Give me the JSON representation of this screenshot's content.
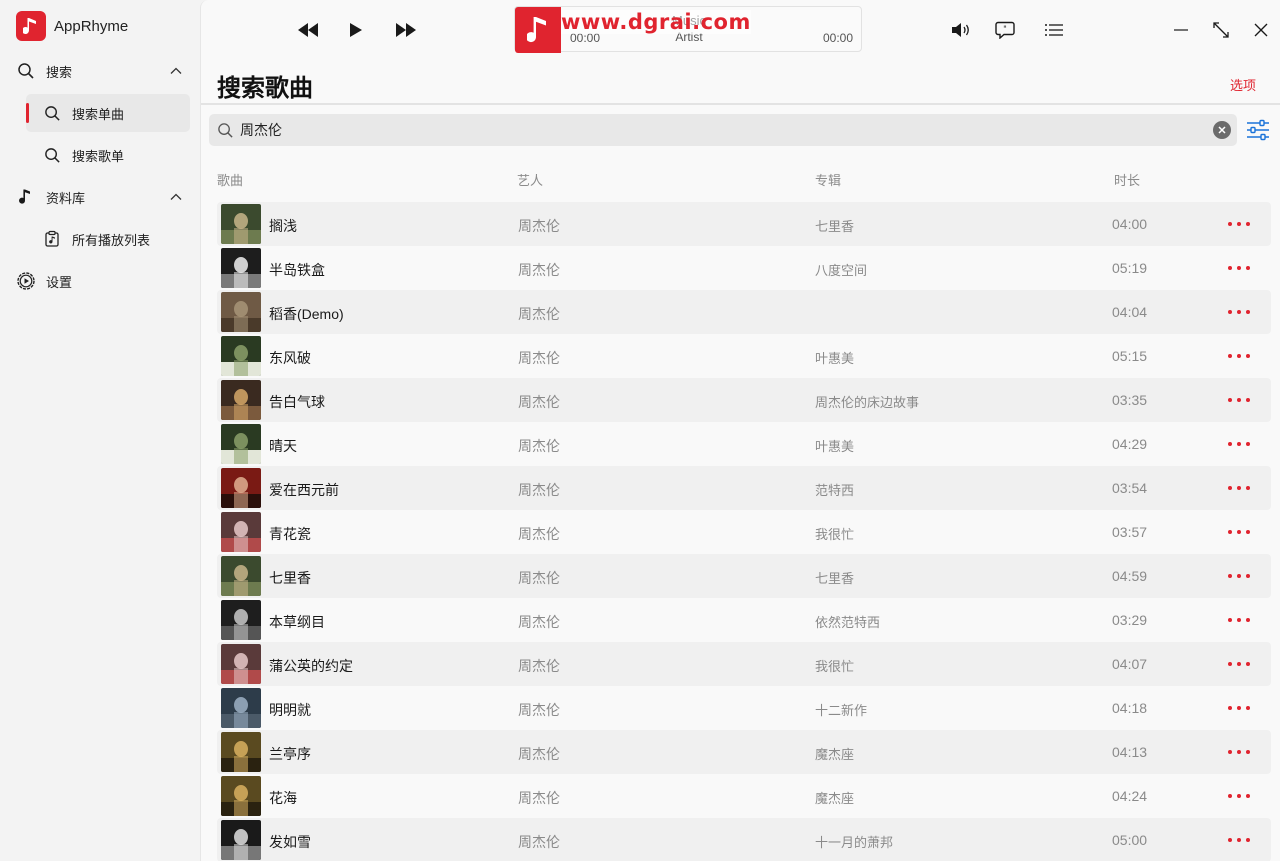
{
  "app": {
    "name": "AppRhyme"
  },
  "sidebar": {
    "items": [
      {
        "label": "搜索",
        "icon": "search-icon",
        "expanded": true
      },
      {
        "label": "搜索单曲",
        "icon": "search-icon",
        "active": true
      },
      {
        "label": "搜索歌单",
        "icon": "search-icon"
      },
      {
        "label": "资料库",
        "icon": "music-note-icon",
        "expanded": true
      },
      {
        "label": "所有播放列表",
        "icon": "playlist-icon"
      },
      {
        "label": "设置",
        "icon": "settings-icon"
      }
    ]
  },
  "player": {
    "title": "Music",
    "artist": "Artist",
    "time_elapsed": "00:00",
    "time_total": "00:00"
  },
  "watermark": "www.dgrai.com",
  "page": {
    "title": "搜索歌曲",
    "options_label": "选项"
  },
  "search": {
    "value": "周杰伦"
  },
  "table": {
    "headers": {
      "title": "歌曲",
      "artist": "艺人",
      "album": "专辑",
      "duration": "时长"
    },
    "rows": [
      {
        "title": "搁浅",
        "artist": "周杰伦",
        "album": "七里香",
        "duration": "04:00"
      },
      {
        "title": "半岛铁盒",
        "artist": "周杰伦",
        "album": "八度空间",
        "duration": "05:19"
      },
      {
        "title": "稻香(Demo)",
        "artist": "周杰伦",
        "album": "",
        "duration": "04:04"
      },
      {
        "title": "东风破",
        "artist": "周杰伦",
        "album": "叶惠美",
        "duration": "05:15"
      },
      {
        "title": "告白气球",
        "artist": "周杰伦",
        "album": "周杰伦的床边故事",
        "duration": "03:35"
      },
      {
        "title": "晴天",
        "artist": "周杰伦",
        "album": "叶惠美",
        "duration": "04:29"
      },
      {
        "title": "爱在西元前",
        "artist": "周杰伦",
        "album": "范特西",
        "duration": "03:54"
      },
      {
        "title": "青花瓷",
        "artist": "周杰伦",
        "album": "我很忙",
        "duration": "03:57"
      },
      {
        "title": "七里香",
        "artist": "周杰伦",
        "album": "七里香",
        "duration": "04:59"
      },
      {
        "title": "本草纲目",
        "artist": "周杰伦",
        "album": "依然范特西",
        "duration": "03:29"
      },
      {
        "title": "蒲公英的约定",
        "artist": "周杰伦",
        "album": "我很忙",
        "duration": "04:07"
      },
      {
        "title": "明明就",
        "artist": "周杰伦",
        "album": "十二新作",
        "duration": "04:18"
      },
      {
        "title": "兰亭序",
        "artist": "周杰伦",
        "album": "魔杰座",
        "duration": "04:13"
      },
      {
        "title": "花海",
        "artist": "周杰伦",
        "album": "魔杰座",
        "duration": "04:24"
      },
      {
        "title": "发如雪",
        "artist": "周杰伦",
        "album": "十一月的萧邦",
        "duration": "05:00"
      }
    ]
  },
  "colors": {
    "accent": "#e0242f",
    "muted": "#8a8a8a",
    "sidebar_bg": "#f3f3f3"
  }
}
